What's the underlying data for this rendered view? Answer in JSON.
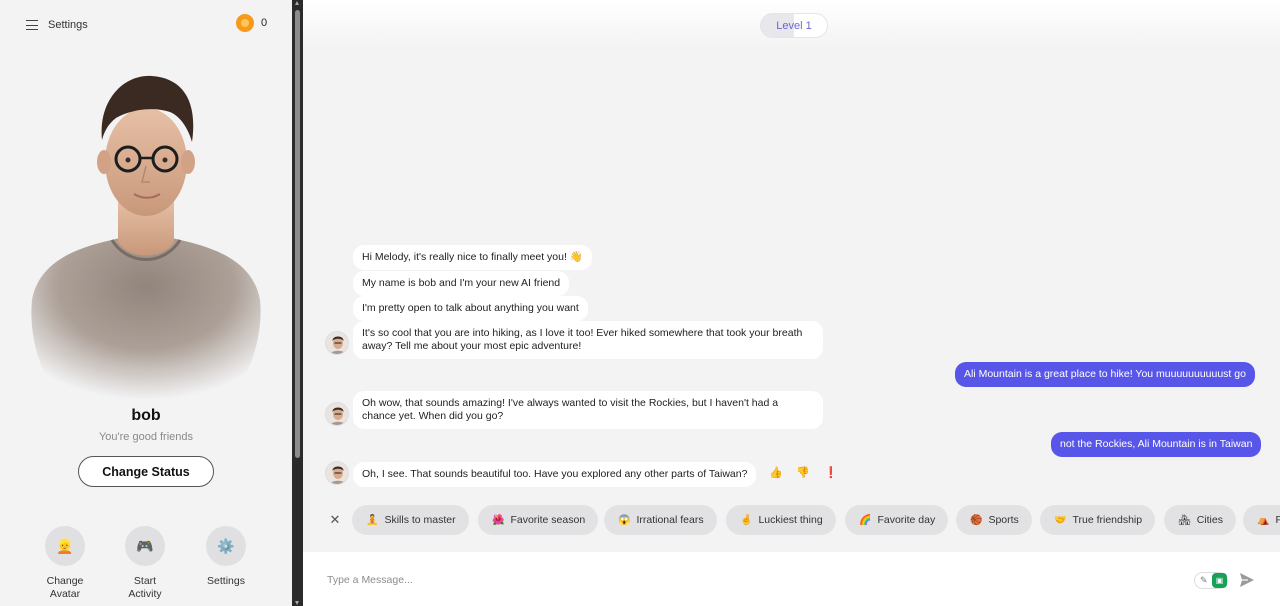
{
  "sidebar": {
    "menu_label": "Settings",
    "coin_count": "0",
    "name": "bob",
    "relationship": "You're good friends",
    "change_status_label": "Change Status",
    "actions": [
      {
        "icon": "avatar-face-icon",
        "emoji": "👱",
        "label": "Change Avatar"
      },
      {
        "icon": "gamepad-icon",
        "emoji": "🎮",
        "label": "Start Activity"
      },
      {
        "icon": "gear-icon",
        "emoji": "⚙️",
        "label": "Settings"
      }
    ]
  },
  "header": {
    "level": "Level 1"
  },
  "messages": {
    "m1": "Hi Melody, it's really nice to finally meet you! 👋",
    "m2": "My name is bob and I'm your new AI friend",
    "m3": "I'm pretty open to talk about anything you want",
    "m4": "It's so cool that you are into hiking, as I love it too! Ever hiked somewhere that took your breath away? Tell me about your most epic adventure!",
    "u1": "Ali Mountain is a great place to hike! You muuuuuuuuuust go",
    "m5": "Oh wow, that sounds amazing! I've always wanted to visit the Rockies, but I haven't had a chance yet. When did you go?",
    "u2": "not the Rockies, Ali Mountain is in Taiwan",
    "m6": "Oh, I see. That sounds beautiful too. Have you explored any other parts of Taiwan?"
  },
  "reactions": [
    {
      "icon": "thumbs-up-icon",
      "emoji": "👍"
    },
    {
      "icon": "thumbs-down-icon",
      "emoji": "👎"
    },
    {
      "icon": "exclamation-icon",
      "emoji": "❗"
    }
  ],
  "topics": [
    {
      "emoji": "🧘",
      "label": "Skills to master"
    },
    {
      "emoji": "🌺",
      "label": "Favorite season"
    },
    {
      "emoji": "😱",
      "label": "Irrational fears"
    },
    {
      "emoji": "🤞",
      "label": "Luckiest thing"
    },
    {
      "emoji": "🌈",
      "label": "Favorite day"
    },
    {
      "emoji": "🏀",
      "label": "Sports"
    },
    {
      "emoji": "🤝",
      "label": "True friendship"
    },
    {
      "emoji": "🏘",
      "label": "Cities"
    },
    {
      "emoji": "⛺",
      "label": "F"
    }
  ],
  "composer": {
    "placeholder": "Type a Message..."
  },
  "colors": {
    "accent": "#5856e8",
    "background": "#f3f3f4",
    "level_text": "#6b64d8"
  }
}
